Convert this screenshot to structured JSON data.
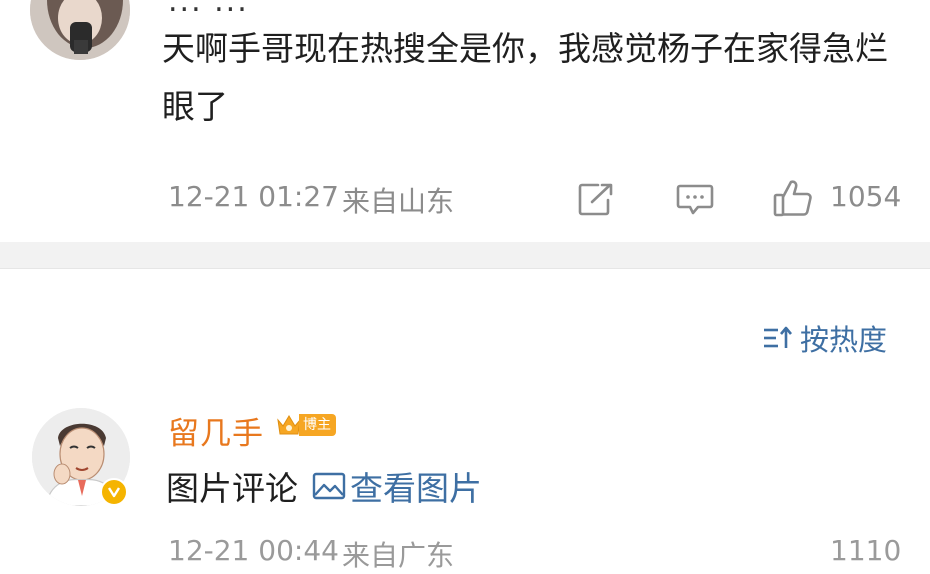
{
  "top_comment": {
    "name_fragment": "... ...",
    "text": "天啊手哥现在热搜全是你，我感觉杨子在家得急烂眼了",
    "time": "12-21 01:27",
    "location": "来自山东",
    "like_count": "1054"
  },
  "sort": {
    "label": "按热度"
  },
  "second_comment": {
    "user_name": "留几手",
    "badge_label": "博主",
    "text": "图片评论",
    "view_image_label": "查看图片",
    "time_partial": "12-21 00:44",
    "location_partial": "来自广东",
    "like_count_partial": "1110"
  },
  "colors": {
    "link": "#3e6fa3",
    "username": "#e8781e",
    "meta": "#8c8c8c",
    "divider": "#f2f2f2"
  }
}
